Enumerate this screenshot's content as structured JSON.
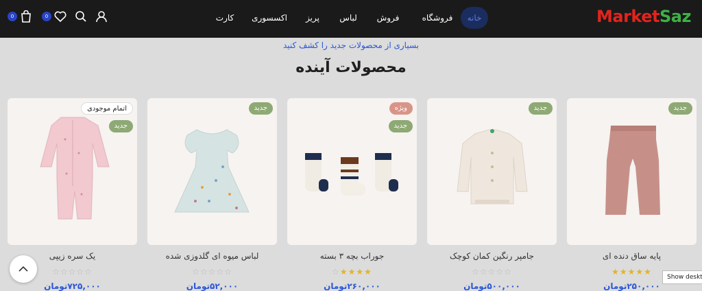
{
  "brand": {
    "part1": "Market",
    "part2": "Saz"
  },
  "nav": [
    {
      "label": "خانه",
      "active": true
    },
    {
      "label": "فروشگاه",
      "active": false
    },
    {
      "label": "فروش",
      "active": false
    },
    {
      "label": "لباس",
      "active": false
    },
    {
      "label": "پریز",
      "active": false
    },
    {
      "label": "اکسسوری",
      "active": false
    },
    {
      "label": "کارت",
      "active": false
    }
  ],
  "header_icons": {
    "cart_count": "0",
    "wishlist_count": "0"
  },
  "section": {
    "subtitle": "بسیاری از محصولات جدید را کشف کنید",
    "title": "محصولات آینده"
  },
  "products": [
    {
      "name": "پایه ساق دنده ای",
      "price": "۲۵۰,۰۰۰تومان",
      "rating": 5,
      "tags": [
        "جدید"
      ]
    },
    {
      "name": "جامپر رنگین کمان کوچک",
      "price": "۵۰۰,۰۰۰تومان",
      "rating": 0,
      "tags": [
        "جدید"
      ]
    },
    {
      "name": "جوراب بچه ۳ بسته",
      "price": "۲۶۰,۰۰۰تومان",
      "rating": 4,
      "tags": [
        "ویژه",
        "جدید"
      ]
    },
    {
      "name": "لباس میوه ای گلدوزی شده",
      "price": "۵۲,۰۰۰تومان",
      "rating": 0,
      "tags": [
        "جدید"
      ]
    },
    {
      "name": "یک سره زیپی",
      "price": "۷۲۵,۰۰۰تومان",
      "rating": 0,
      "tags": [
        "اتمام موجودی",
        "جدید"
      ]
    }
  ],
  "tooltip": "Show desktop"
}
